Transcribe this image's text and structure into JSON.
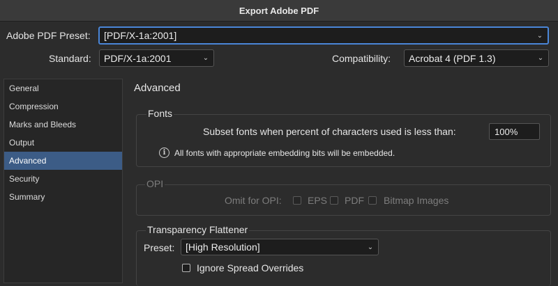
{
  "window": {
    "title": "Export Adobe PDF"
  },
  "preset": {
    "label": "Adobe PDF Preset:",
    "value": "[PDF/X-1a:2001]"
  },
  "standard": {
    "label": "Standard:",
    "value": "PDF/X-1a:2001"
  },
  "compatibility": {
    "label": "Compatibility:",
    "value": "Acrobat 4 (PDF 1.3)"
  },
  "sidebar": {
    "items": [
      {
        "label": "General"
      },
      {
        "label": "Compression"
      },
      {
        "label": "Marks and Bleeds"
      },
      {
        "label": "Output"
      },
      {
        "label": "Advanced",
        "active": true
      },
      {
        "label": "Security"
      },
      {
        "label": "Summary"
      }
    ]
  },
  "main": {
    "title": "Advanced",
    "fonts": {
      "title": "Fonts",
      "subset_label": "Subset fonts when percent of characters used is less than:",
      "subset_value": "100%",
      "info_text": "All fonts with appropriate embedding bits will be embedded."
    },
    "opi": {
      "title": "OPI",
      "omit_label": "Omit for OPI:",
      "options": [
        "EPS",
        "PDF",
        "Bitmap Images"
      ]
    },
    "transparency": {
      "title": "Transparency Flattener",
      "preset_label": "Preset:",
      "preset_value": "[High Resolution]",
      "ignore_label": "Ignore Spread Overrides"
    }
  },
  "colors": {
    "accent": "#4a86d8",
    "selection": "#3c5c86",
    "background": "#2c2c2c"
  }
}
